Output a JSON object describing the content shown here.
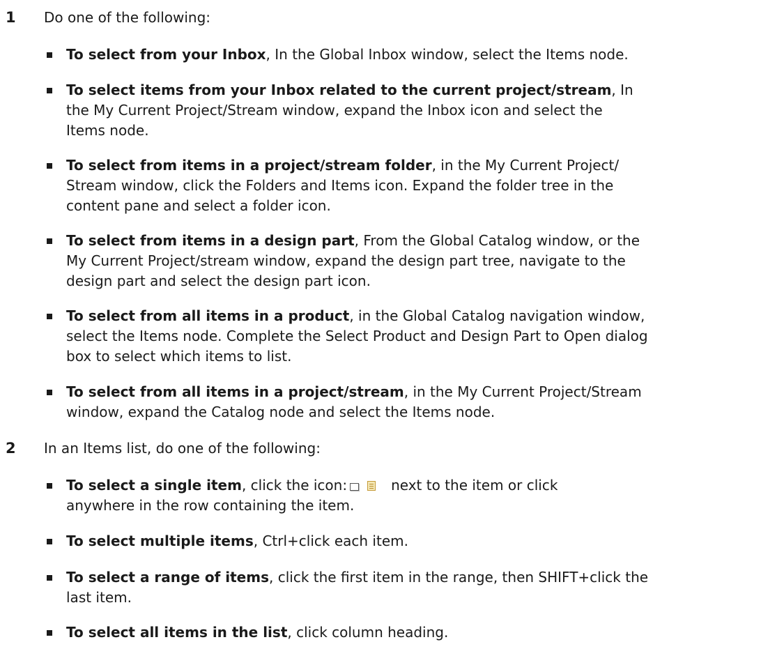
{
  "steps": [
    {
      "number": "1",
      "text": "Do one of the following:",
      "bullets": [
        {
          "bold": "To select from your Inbox",
          "lines": [
            ", In the Global Inbox window, select the Items node."
          ]
        },
        {
          "bold": "To select items from your Inbox related to the current project/stream",
          "lines": [
            ", In",
            "the My Current Project/Stream window, expand the Inbox icon and select the",
            "Items node."
          ]
        },
        {
          "bold": "To select from items in a project/stream folder",
          "lines": [
            ", in the My Current Project/",
            "Stream window, click the Folders and Items icon. Expand the folder tree in the",
            "content pane and select a folder icon."
          ]
        },
        {
          "bold": "To select from items in a design part",
          "lines": [
            ", From the Global Catalog window, or the",
            "My Current Project/stream window, expand the design part tree, navigate to the",
            "design part and select the design part icon."
          ]
        },
        {
          "bold": "To select from all items in a product",
          "lines": [
            ", in the Global Catalog navigation window,",
            "select the Items node. Complete the Select Product and Design Part to Open dialog",
            "box to select which items to list."
          ]
        },
        {
          "bold": "To select from all items in a project/stream",
          "lines": [
            ", in the My Current Project/Stream",
            "window, expand the Catalog node and select the Items node."
          ]
        }
      ]
    },
    {
      "number": "2",
      "text": "In an Items list, do one of the following:",
      "bullets": [
        {
          "bold": "To select a single item",
          "lines": [
            ", click the icon:",
            "next to the item or click",
            "anywhere in the row containing the item."
          ],
          "icons": [
            "item-checkbox-icon",
            "item-document-icon"
          ]
        },
        {
          "bold": "To select multiple items",
          "lines": [
            ", Ctrl+click each item."
          ]
        },
        {
          "bold": "To select a range of items",
          "lines": [
            ", click the first item in the range, then SHIFT+click the",
            "last item."
          ]
        },
        {
          "bold": "To select all items in the list",
          "lines": [
            ", click column heading."
          ]
        }
      ]
    }
  ]
}
